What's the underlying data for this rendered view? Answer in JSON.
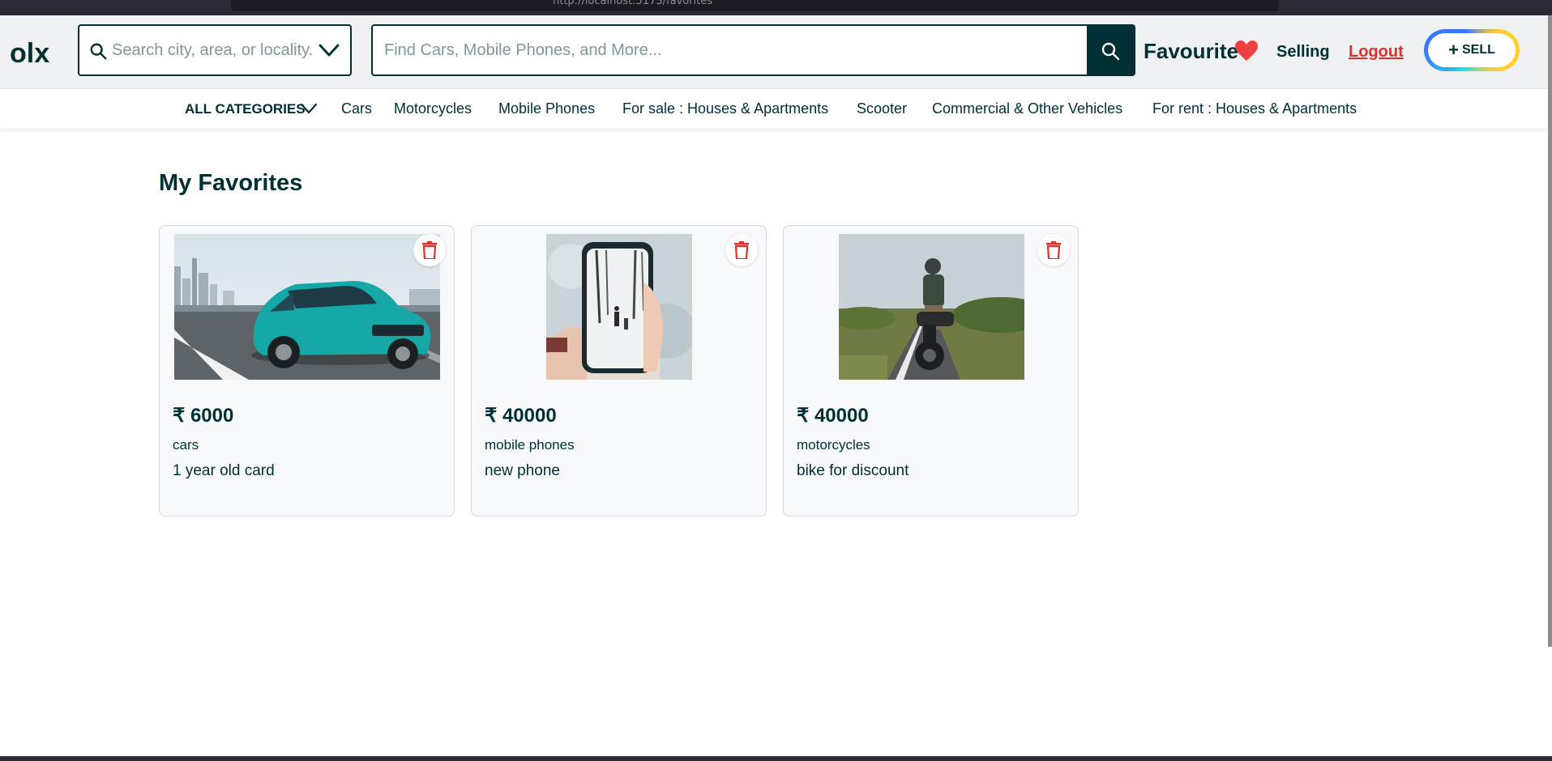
{
  "browser": {
    "url": "http://localhost:5173/favorites"
  },
  "header": {
    "logo_text": "olx",
    "location_search": {
      "placeholder": "Search city, area, or locality...",
      "value": ""
    },
    "main_search": {
      "placeholder": "Find Cars, Mobile Phones, and More...",
      "value": ""
    },
    "favourite_label": "Favourite",
    "selling_label": "Selling",
    "logout_label": "Logout",
    "sell_button": {
      "plus": "+",
      "label": "SELL"
    }
  },
  "categories": {
    "all_label": "ALL CATEGORIES",
    "items": [
      "Cars",
      "Motorcycles",
      "Mobile Phones",
      "For sale : Houses & Apartments",
      "Scooter",
      "Commercial & Other Vehicles",
      "For rent : Houses & Apartments"
    ]
  },
  "main": {
    "title": "My Favorites",
    "favorites": [
      {
        "price": "₹ 6000",
        "category": "cars",
        "description": "1 year old card",
        "image": "teal-hatchback-car-photo"
      },
      {
        "price": "₹ 40000",
        "category": "mobile phones",
        "description": "new phone",
        "image": "hand-holding-phone-photo"
      },
      {
        "price": "₹ 40000",
        "category": "motorcycles",
        "description": "bike for discount",
        "image": "rider-on-motorcycle-photo"
      }
    ]
  },
  "colors": {
    "brand": "#002f34",
    "logout": "#e0302b",
    "heart": "#ef3f3f",
    "delete": "#e0302b",
    "card_bg": "#f8f9fa"
  }
}
